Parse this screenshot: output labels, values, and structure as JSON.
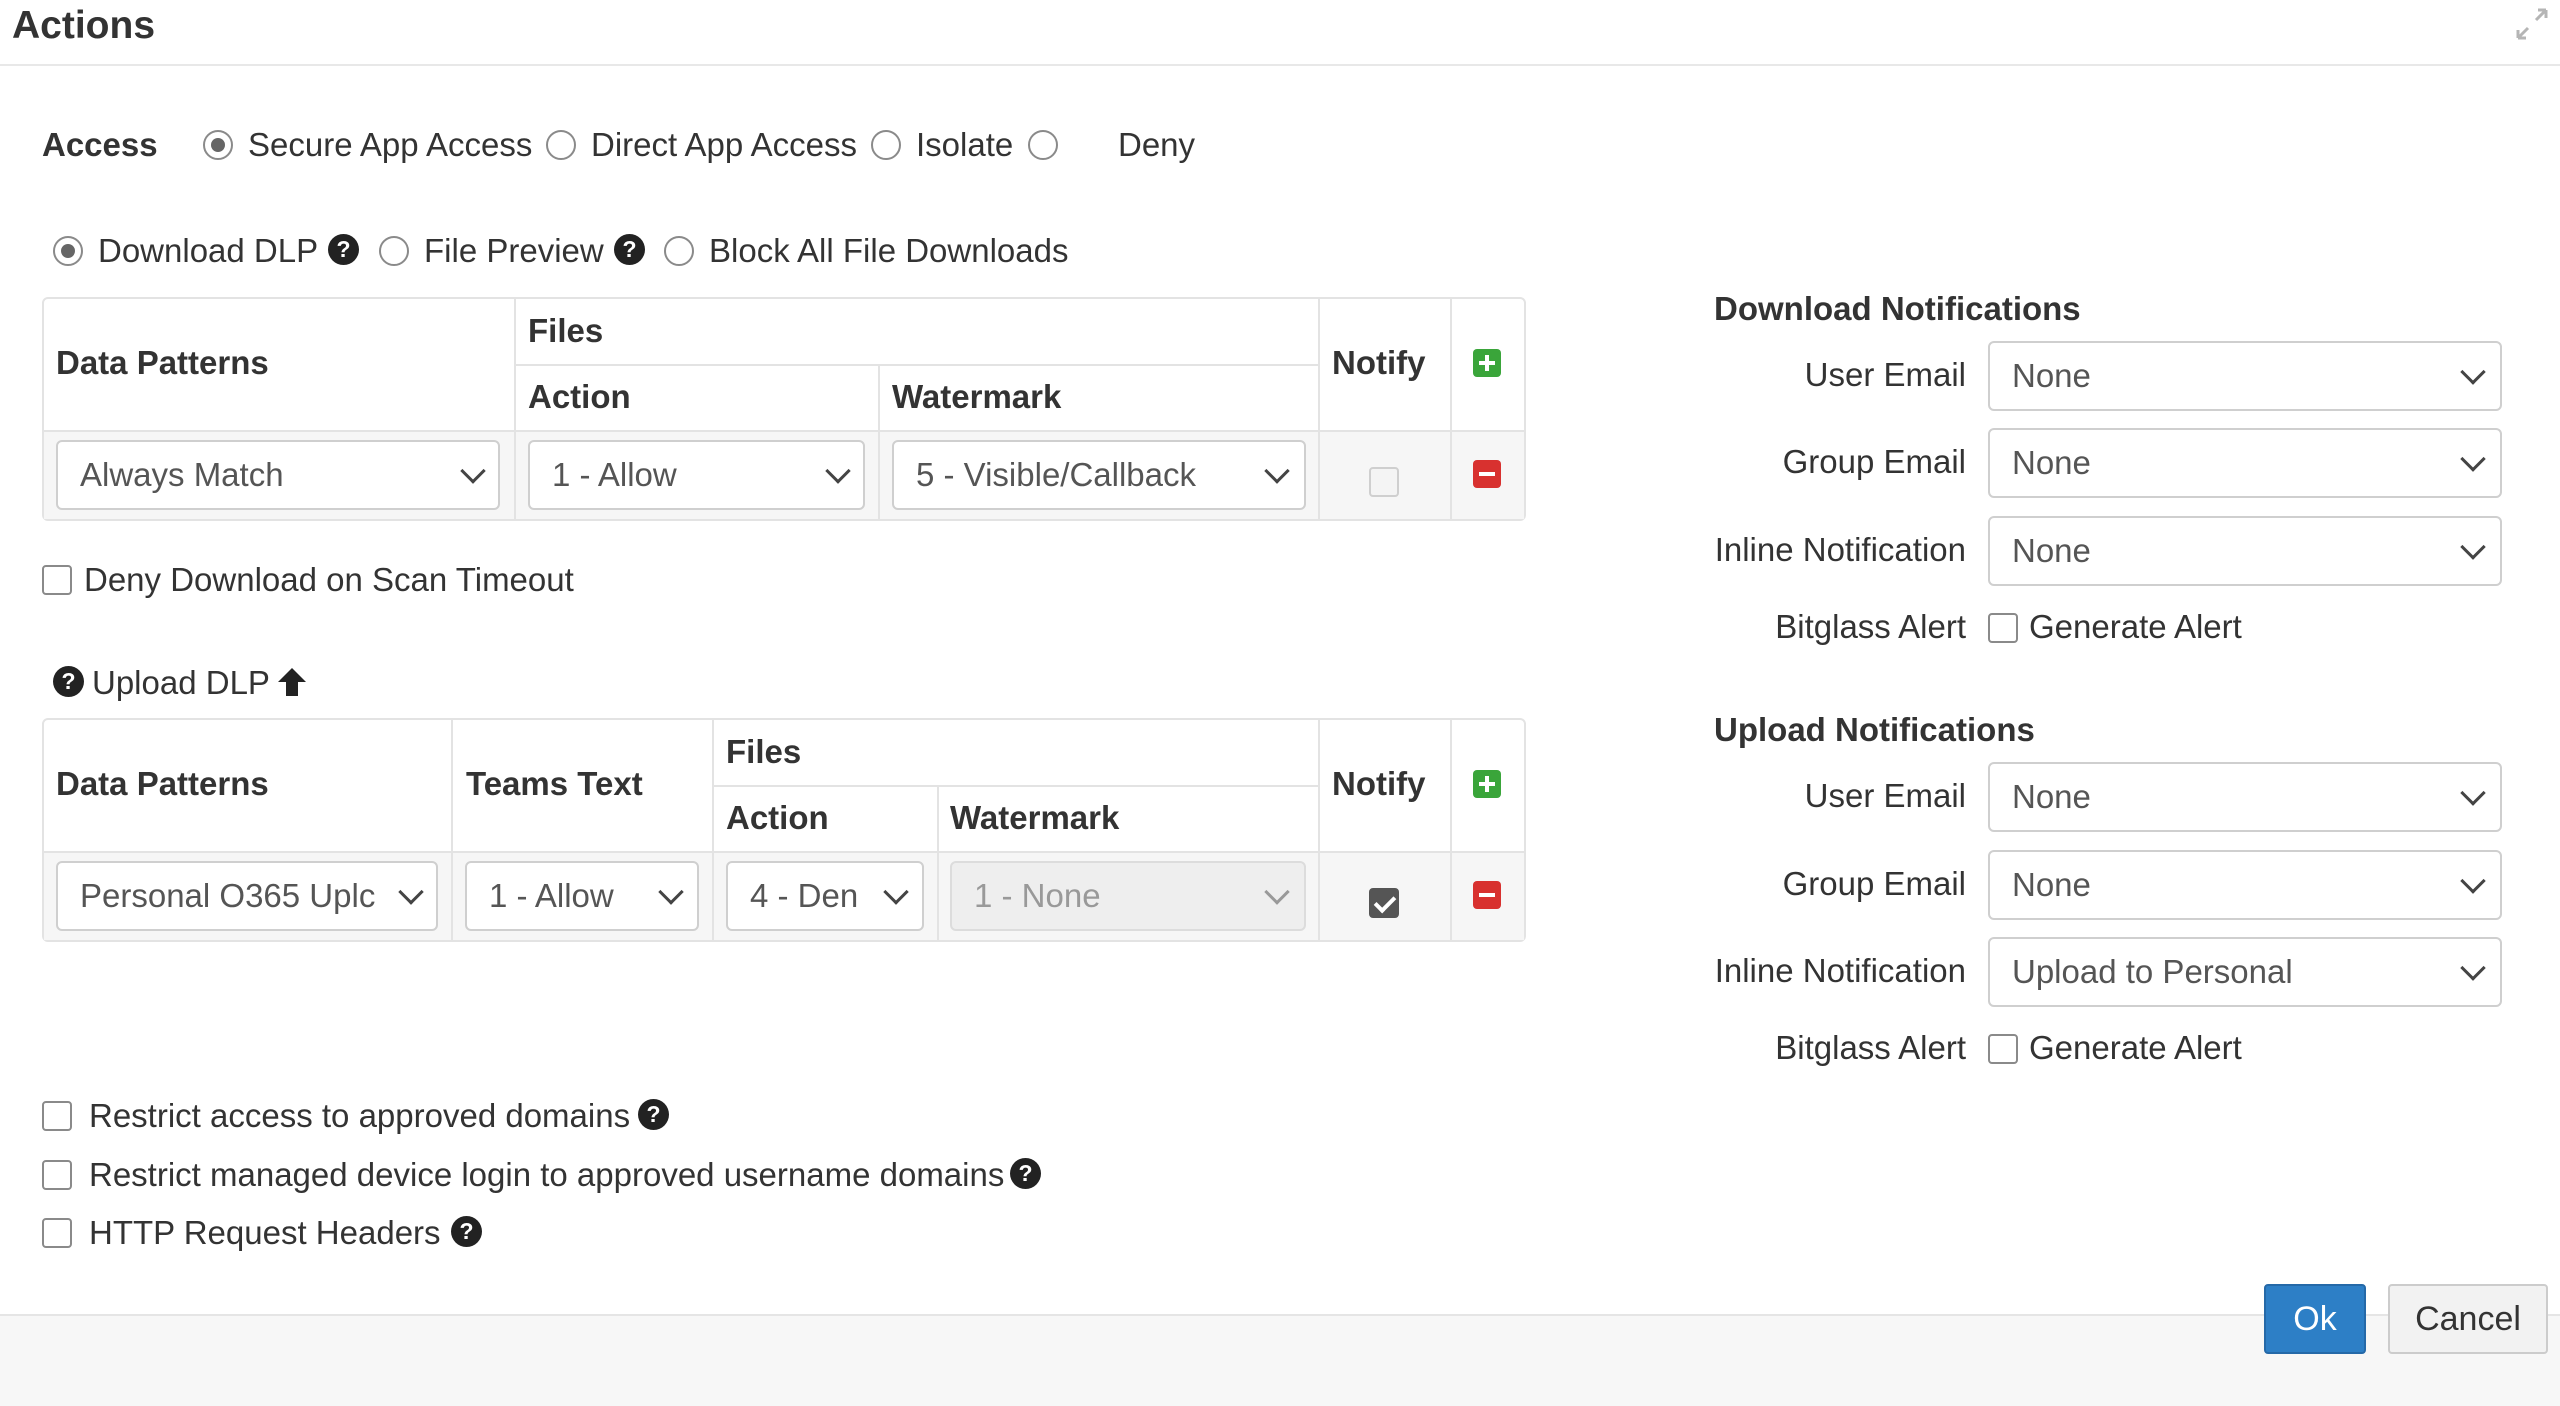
{
  "dialog": {
    "title": "Actions"
  },
  "access": {
    "label": "Access",
    "options": [
      "Secure App Access",
      "Direct App Access",
      "Isolate",
      "Deny"
    ],
    "selected": "Secure App Access"
  },
  "download_mode": {
    "options": [
      "Download DLP",
      "File Preview",
      "Block All File Downloads"
    ],
    "selected": "Download DLP"
  },
  "download_table": {
    "headers": {
      "data_patterns": "Data Patterns",
      "files": "Files",
      "action": "Action",
      "watermark": "Watermark",
      "notify": "Notify"
    },
    "rows": [
      {
        "data_pattern": "Always Match",
        "action": "1 - Allow",
        "watermark": "5 - Visible/Callback",
        "notify": false
      }
    ]
  },
  "deny_scan_timeout": {
    "label": "Deny Download on Scan Timeout",
    "checked": false
  },
  "upload": {
    "title": "Upload DLP",
    "headers": {
      "data_patterns": "Data Patterns",
      "teams_text": "Teams Text",
      "files": "Files",
      "action": "Action",
      "watermark": "Watermark",
      "notify": "Notify"
    },
    "rows": [
      {
        "data_pattern": "Personal O365 Uplc",
        "teams_text": "1 - Allow",
        "action": "4 - Den",
        "watermark": "1 - None",
        "notify": true
      }
    ]
  },
  "options": [
    {
      "label": "Restrict access to approved domains",
      "checked": false
    },
    {
      "label": "Restrict managed device login to approved username domains",
      "checked": false
    },
    {
      "label": "HTTP Request Headers",
      "checked": false
    }
  ],
  "download_notifications": {
    "title": "Download Notifications",
    "user_email_label": "User Email",
    "user_email": "None",
    "group_email_label": "Group Email",
    "group_email": "None",
    "inline_label": "Inline Notification",
    "inline": "None",
    "bitglass_label": "Bitglass Alert",
    "generate_label": "Generate Alert"
  },
  "upload_notifications": {
    "title": "Upload Notifications",
    "user_email_label": "User Email",
    "user_email": "None",
    "group_email_label": "Group Email",
    "group_email": "None",
    "inline_label": "Inline Notification",
    "inline": "Upload to Personal",
    "bitglass_label": "Bitglass Alert",
    "generate_label": "Generate Alert"
  },
  "footer": {
    "ok": "Ok",
    "cancel": "Cancel"
  },
  "colors": {
    "primary": "#2d7fc6",
    "add": "#3aa53a",
    "remove": "#d8312f"
  }
}
